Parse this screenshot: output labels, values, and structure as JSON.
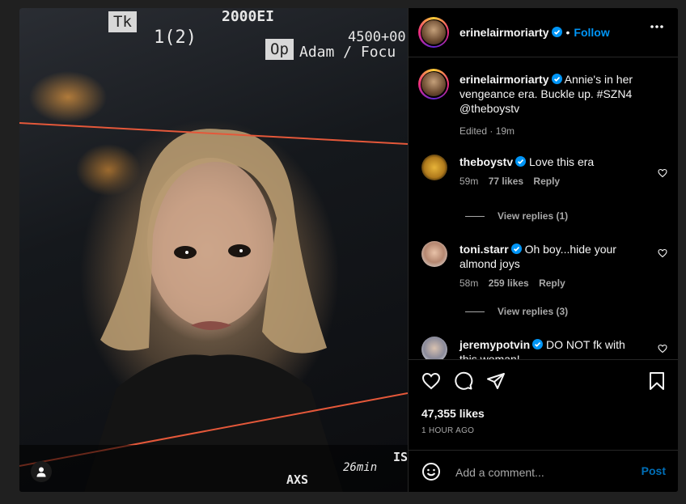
{
  "media": {
    "hud": {
      "take_label": "Tk",
      "take_value": "1(2)",
      "ei": "2000EI",
      "kelvin": "4500+00",
      "op_label": "Op",
      "op_value": "Adam / Focu",
      "bottom_codec": "AXS",
      "bottom_remain": "26min",
      "bottom_edge": "IS"
    }
  },
  "post": {
    "author": "erinelairmoriarty",
    "follow_label": "Follow",
    "separator": "•",
    "caption": "Annie's in her vengeance era. Buckle up. #SZN4 @theboystv",
    "caption_meta": "Edited · 19m"
  },
  "comments": [
    {
      "user": "theboystv",
      "text": "Love this era",
      "age": "59m",
      "likes": "77 likes",
      "reply": "Reply",
      "view_replies": "View replies (1)"
    },
    {
      "user": "toni.starr",
      "text": "Oh boy...hide your almond joys",
      "age": "58m",
      "likes": "259 likes",
      "reply": "Reply",
      "view_replies": "View replies (3)"
    },
    {
      "user": "jeremypotvin",
      "text": "DO NOT fk with this woman!"
    }
  ],
  "stats": {
    "likes": "47,355 likes",
    "time": "1 HOUR AGO"
  },
  "composer": {
    "placeholder": "Add a comment...",
    "post_label": "Post"
  },
  "colors": {
    "accent": "#0095f6",
    "background": "#000000",
    "muted": "#a8a8a8"
  },
  "icons": [
    "more-icon",
    "verified-icon",
    "heart-icon",
    "comment-icon",
    "share-icon",
    "bookmark-icon",
    "emoji-icon",
    "user-tag-icon"
  ]
}
